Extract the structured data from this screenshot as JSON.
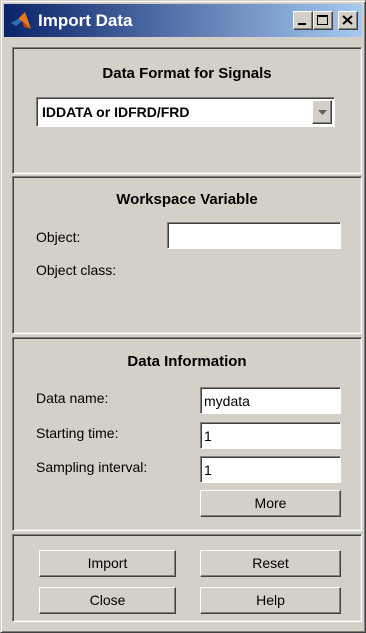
{
  "window": {
    "title": "Import Data"
  },
  "data_format": {
    "title": "Data Format for Signals",
    "selected": "IDDATA or IDFRD/FRD"
  },
  "workspace": {
    "title": "Workspace Variable",
    "object_label": "Object:",
    "object_value": "",
    "object_class_label": "Object class:"
  },
  "info": {
    "title": "Data Information",
    "name_label": "Data name:",
    "name_value": "mydata",
    "start_label": "Starting time:",
    "start_value": "1",
    "interval_label": "Sampling interval:",
    "interval_value": "1",
    "more_label": "More"
  },
  "actions": {
    "import_label": "Import",
    "reset_label": "Reset",
    "close_label": "Close",
    "help_label": "Help"
  },
  "colors": {
    "titlebar_start": "#0a246a",
    "titlebar_end": "#a6caf0",
    "face": "#d4d0c8"
  },
  "icons": [
    "matlab-logo-icon",
    "minimize-icon",
    "maximize-icon",
    "close-icon",
    "dropdown-arrow-icon"
  ]
}
